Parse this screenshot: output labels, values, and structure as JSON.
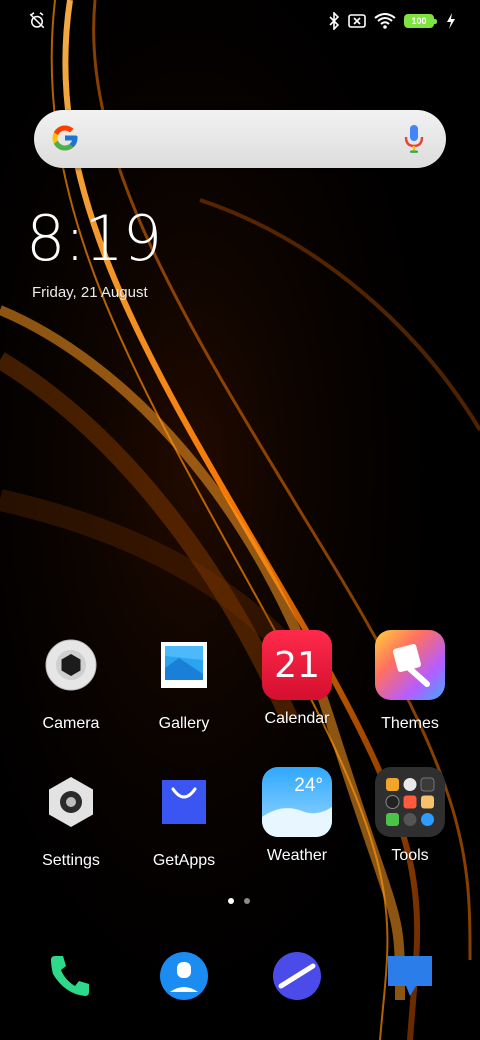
{
  "status_bar": {
    "left_icon": "alarm-off-icon",
    "right_icons": [
      "bluetooth-icon",
      "sim-x-icon",
      "wifi-icon",
      "battery-icon",
      "charging-bolt-icon"
    ],
    "battery_level": "100",
    "battery_color": "#7ee23f"
  },
  "search": {
    "logo": "google-g-icon",
    "mic": "microphone-icon"
  },
  "clock": {
    "time": "8:19",
    "date": "Friday, 21 August"
  },
  "apps": [
    {
      "label": "Camera",
      "icon": "camera-icon"
    },
    {
      "label": "Gallery",
      "icon": "gallery-icon"
    },
    {
      "label": "Calendar",
      "icon": "calendar-icon",
      "badge_text": "21"
    },
    {
      "label": "Themes",
      "icon": "themes-icon"
    },
    {
      "label": "Settings",
      "icon": "settings-gear-icon"
    },
    {
      "label": "GetApps",
      "icon": "getapps-bag-icon"
    },
    {
      "label": "Weather",
      "icon": "weather-icon",
      "badge_text": "24°"
    },
    {
      "label": "Tools",
      "icon": "tools-folder-icon"
    }
  ],
  "page_indicator": {
    "pages": 2,
    "active": 1
  },
  "dock": [
    {
      "icon": "phone-icon"
    },
    {
      "icon": "contacts-icon"
    },
    {
      "icon": "browser-icon"
    },
    {
      "icon": "messages-icon"
    }
  ],
  "colors": {
    "wallpaper_base": "#000000",
    "wallpaper_accent": "#ff8a00",
    "calendar": "#e8193c",
    "getapps": "#3a55f2",
    "phone": "#2fd98a",
    "contacts": "#1a8cf2",
    "browser": "#4a4be8",
    "messages": "#2b7de9"
  }
}
